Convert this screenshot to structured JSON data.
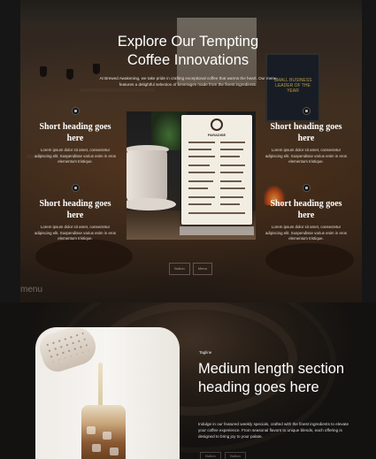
{
  "hero": {
    "title_line1": "Explore Our Tempting",
    "title_line2": "Coffee Innovations",
    "intro": "At Brewed Awakening, we take pride in crafting exceptional coffee that warms the heart. Our menu features a delightful selection of beverages made from the finest ingredients.",
    "features": [
      {
        "heading": "Short heading goes here",
        "body": "Lorem ipsum dolor sit amet, consectetur adipiscing elit. Suspendisse varius enim in eros elementum tristique."
      },
      {
        "heading": "Short heading goes here",
        "body": "Lorem ipsum dolor sit amet, consectetur adipiscing elit. Suspendisse varius enim in eros elementum tristique."
      },
      {
        "heading": "Short heading goes here",
        "body": "Lorem ipsum dolor sit amet, consectetur adipiscing elit. Suspendisse varius enim in eros elementum tristique."
      },
      {
        "heading": "Short heading goes here",
        "body": "Lorem ipsum dolor sit amet, consectetur adipiscing elit. Suspendisse varius enim in eros elementum tristique."
      }
    ],
    "menu_card_brand": "PARADISE",
    "poster_text": "SMALL BUSINESS LEADER OF THE YEAR",
    "ghost_buttons": [
      "Button",
      "Menu"
    ],
    "ghost_label": "menu"
  },
  "section": {
    "tagline": "Tagline",
    "title": "Medium length section heading goes here",
    "body": "Indulge in our featured weekly specials, crafted with the finest ingredients to elevate your coffee experience. From seasonal flavors to unique blends, each offering is designed to bring joy to your palate.",
    "ghost_buttons": [
      "Button",
      "Button"
    ]
  },
  "colors": {
    "background": "#1b1b1b",
    "text": "#ffffff"
  }
}
